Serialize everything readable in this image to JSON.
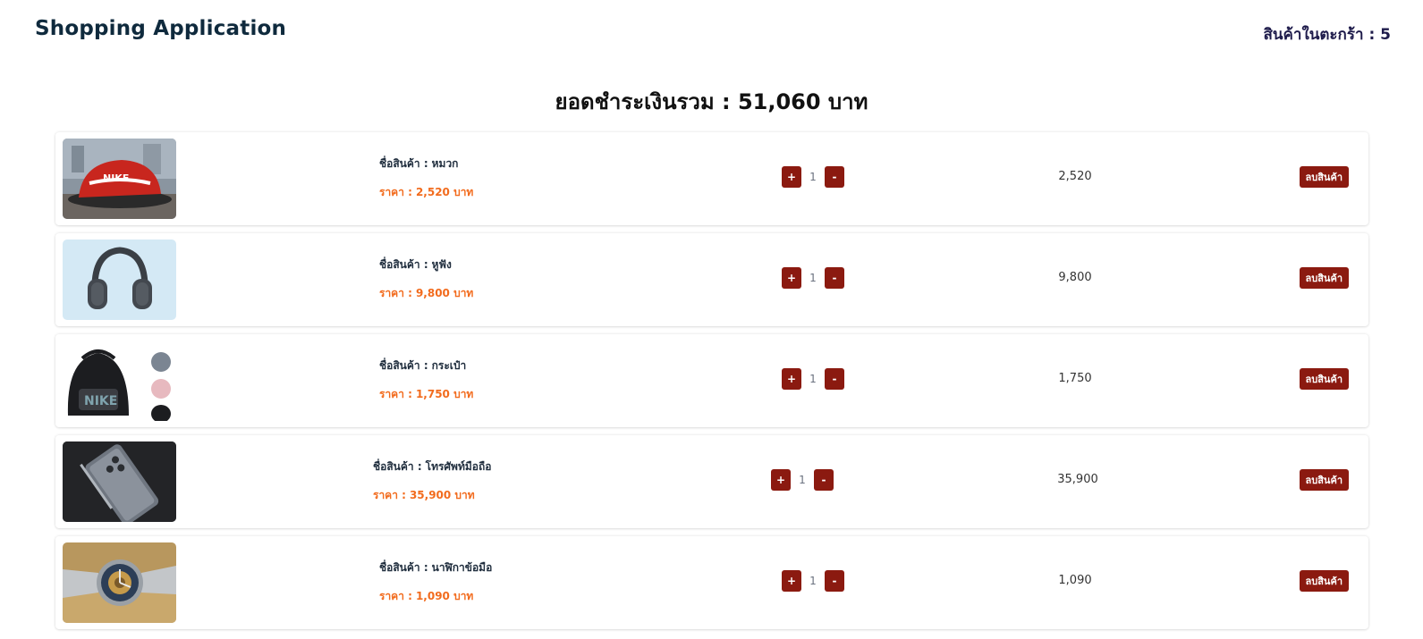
{
  "header": {
    "title": "Shopping Application",
    "cart_count_text": "สินค้าในตะกร้า : 5"
  },
  "summary": {
    "total_text": "ยอดชำระเงินรวม : 51,060 บาท"
  },
  "labels": {
    "name_prefix": "ชื่อสินค้า :",
    "price_prefix": "ราคา :",
    "remove_button": "ลบสินค้า",
    "plus": "+",
    "minus": "-"
  },
  "cart": {
    "items": [
      {
        "name": "หมวก",
        "price_text": "2,520 บาท",
        "qty": "1",
        "subtotal": "2,520",
        "image": "cap-image"
      },
      {
        "name": "หูฟัง",
        "price_text": "9,800 บาท",
        "qty": "1",
        "subtotal": "9,800",
        "image": "headphones-image"
      },
      {
        "name": "กระเป๋า",
        "price_text": "1,750 บาท",
        "qty": "1",
        "subtotal": "1,750",
        "image": "backpack-image"
      },
      {
        "name": "โทรศัพท์มือถือ",
        "price_text": "35,900 บาท",
        "qty": "1",
        "subtotal": "35,900",
        "image": "phone-image"
      },
      {
        "name": "นาฬิกาข้อมือ",
        "price_text": "1,090 บาท",
        "qty": "1",
        "subtotal": "1,090",
        "image": "watch-image"
      }
    ]
  },
  "colors": {
    "accent_button": "#8b1a10",
    "price_text": "#f26b1d",
    "title_text": "#0f2a3d"
  }
}
